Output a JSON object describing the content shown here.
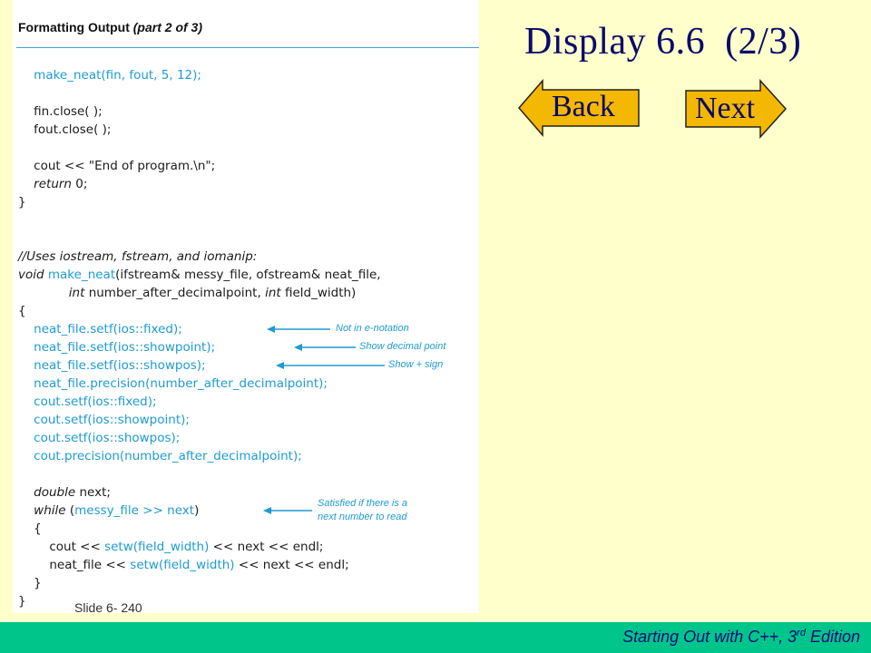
{
  "slide": {
    "title": "Display 6.6  (2/3)",
    "back_label": "Back",
    "next_label": "Next",
    "slide_number": "Slide 6- 240",
    "footer_main": "Starting Out with C++, 3",
    "footer_sup": "rd",
    "footer_tail": " Edition"
  },
  "code": {
    "title_main": "Formatting Output ",
    "title_part": "(part 2 of 3)",
    "lines": [
      [
        "    ",
        {
          "b": "make_neat(fin, fout, 5, 12);"
        }
      ],
      [
        ""
      ],
      [
        "    fin.close( );"
      ],
      [
        "    fout.close( );"
      ],
      [
        ""
      ],
      [
        "    cout << \"End of program.\\n\";"
      ],
      [
        "    ",
        {
          "k": "return"
        },
        " 0;"
      ],
      [
        "}"
      ],
      [
        ""
      ],
      [
        ""
      ],
      [
        {
          "k": "//Uses iostream, fstream, and iomanip:"
        }
      ],
      [
        {
          "k": "void"
        },
        " ",
        {
          "b": "make_neat"
        },
        "(ifstream& messy_file, ofstream& neat_file,"
      ],
      [
        "             ",
        {
          "k": "int"
        },
        " number_after_decimalpoint, ",
        {
          "k": "int"
        },
        " field_width)"
      ],
      [
        "{"
      ],
      [
        "    ",
        {
          "b": "neat_file.setf(ios::fixed);"
        }
      ],
      [
        "    ",
        {
          "b": "neat_file.setf(ios::showpoint);"
        }
      ],
      [
        "    ",
        {
          "b": "neat_file.setf(ios::showpos);"
        }
      ],
      [
        "    ",
        {
          "b": "neat_file.precision(number_after_decimalpoint);"
        }
      ],
      [
        "    ",
        {
          "b": "cout.setf(ios::fixed);"
        }
      ],
      [
        "    ",
        {
          "b": "cout.setf(ios::showpoint);"
        }
      ],
      [
        "    ",
        {
          "b": "cout.setf(ios::showpos);"
        }
      ],
      [
        "    ",
        {
          "b": "cout.precision(number_after_decimalpoint);"
        }
      ],
      [
        ""
      ],
      [
        "    ",
        {
          "k": "double"
        },
        " next;"
      ],
      [
        "    ",
        {
          "k": "while"
        },
        " (",
        {
          "b": "messy_file >> next"
        },
        ")"
      ],
      [
        "    {"
      ],
      [
        "        cout << ",
        {
          "b": "setw(field_width)"
        },
        " << next << endl;"
      ],
      [
        "        neat_file << ",
        {
          "b": "setw(field_width)"
        },
        " << next << endl;"
      ],
      [
        "    }"
      ],
      [
        "}"
      ]
    ],
    "annotations": [
      {
        "name": "annotation-not-in-e-notation",
        "line": 14,
        "text": "Not in e-notation"
      },
      {
        "name": "annotation-show-decimal-point",
        "line": 15,
        "text": "Show decimal point"
      },
      {
        "name": "annotation-show-sign",
        "line": 16,
        "text": "Show + sign"
      },
      {
        "name": "annotation-satisfied-if-next-number",
        "line": 24,
        "text": "Satisfied if there is a",
        "text2": "next number to read"
      }
    ]
  },
  "colors": {
    "background": "#ffffcc",
    "footer": "#00c58a",
    "button_fill": "#f5b800",
    "code_blue": "#1e9bd3",
    "title_text": "#0a0a6a"
  }
}
